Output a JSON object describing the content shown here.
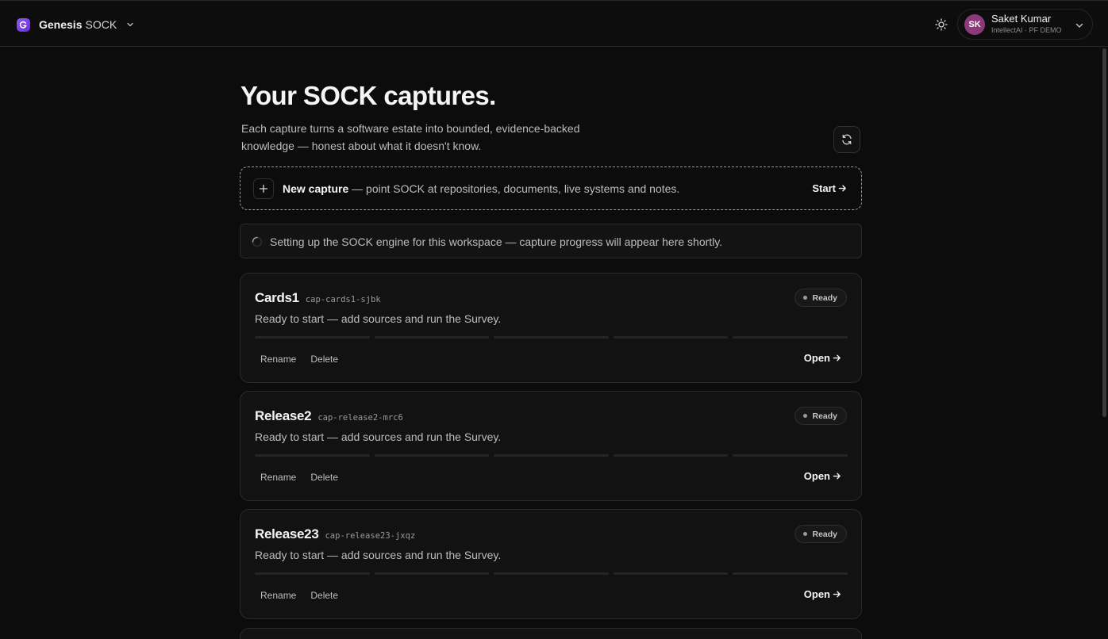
{
  "header": {
    "brand_name": "Genesis",
    "brand_product": "SOCK",
    "user": {
      "initials": "SK",
      "name": "Saket Kumar",
      "org": "IntellectAI · PF DEMO"
    }
  },
  "page": {
    "title": "Your SOCK captures.",
    "subtitle": "Each capture turns a software estate into bounded, evidence-backed knowledge — honest about what it doesn't know."
  },
  "new_capture": {
    "label": "New capture",
    "description": " — point SOCK at repositories, documents, live systems and notes.",
    "action": "Start"
  },
  "status": {
    "message": "Setting up the SOCK engine for this workspace — capture progress will appear here shortly."
  },
  "captures": [
    {
      "name": "Cards1",
      "id": "cap-cards1-sjbk",
      "status": "Ready",
      "description": "Ready to start — add sources and run the Survey.",
      "rename_label": "Rename",
      "delete_label": "Delete",
      "open_label": "Open"
    },
    {
      "name": "Release2",
      "id": "cap-release2-mrc6",
      "status": "Ready",
      "description": "Ready to start — add sources and run the Survey.",
      "rename_label": "Rename",
      "delete_label": "Delete",
      "open_label": "Open"
    },
    {
      "name": "Release23",
      "id": "cap-release23-jxqz",
      "status": "Ready",
      "description": "Ready to start — add sources and run the Survey.",
      "rename_label": "Rename",
      "delete_label": "Delete",
      "open_label": "Open"
    }
  ],
  "icons": {
    "brand": "brand-logo-icon",
    "brand_menu": "chevron-down-icon",
    "theme": "sun-icon",
    "user_menu": "chevron-down-icon",
    "refresh": "refresh-icon",
    "add": "plus-icon",
    "arrow": "arrow-right-icon",
    "loading": "spinner-icon"
  },
  "colors": {
    "background": "#0c0c0c",
    "card": "#121212",
    "brand_accent": "#8b5cf6",
    "avatar": "#8a3a78"
  }
}
